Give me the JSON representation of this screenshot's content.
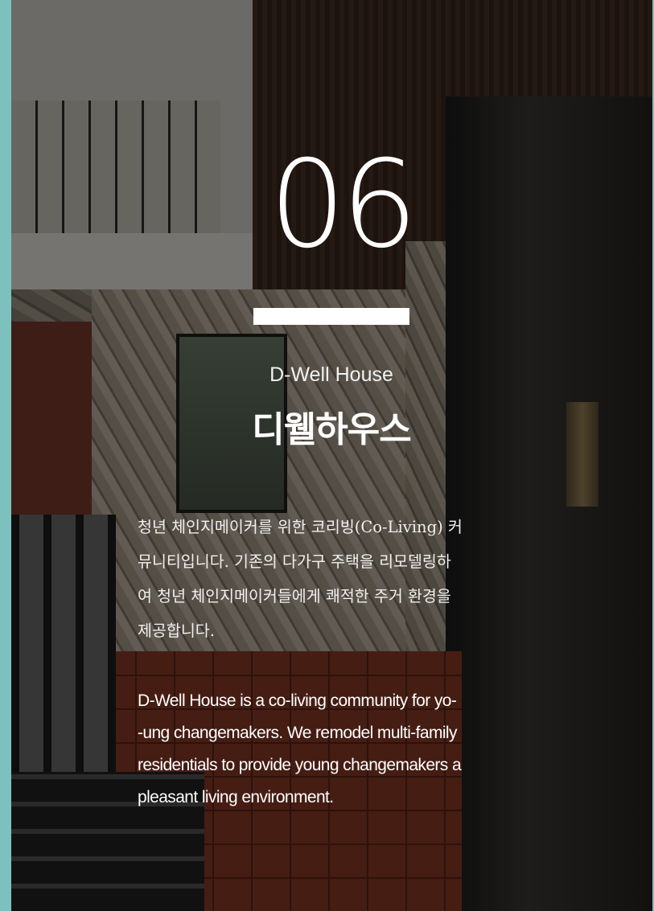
{
  "page": {
    "number": "06",
    "title_en": "D-Well House",
    "title_ko": "디웰하우스",
    "description_ko": "청년 체인지메이커를 위한 코리빙(Co-Living) 커\n뮤니티입니다. 기존의 다가구 주택을 리모델링하\n여 청년 체인지메이커들에게 쾌적한 주거 환경을\n제공합니다.",
    "description_en": "D-Well House is a co-living community for yo-\n-ung changemakers. We remodel multi-family\nresidentials to provide young changemakers a\npleasant living environment."
  },
  "colors": {
    "frame": "#7cc1bd",
    "text": "#ffffff",
    "overlay": "rgba(0,0,0,0.5)"
  }
}
